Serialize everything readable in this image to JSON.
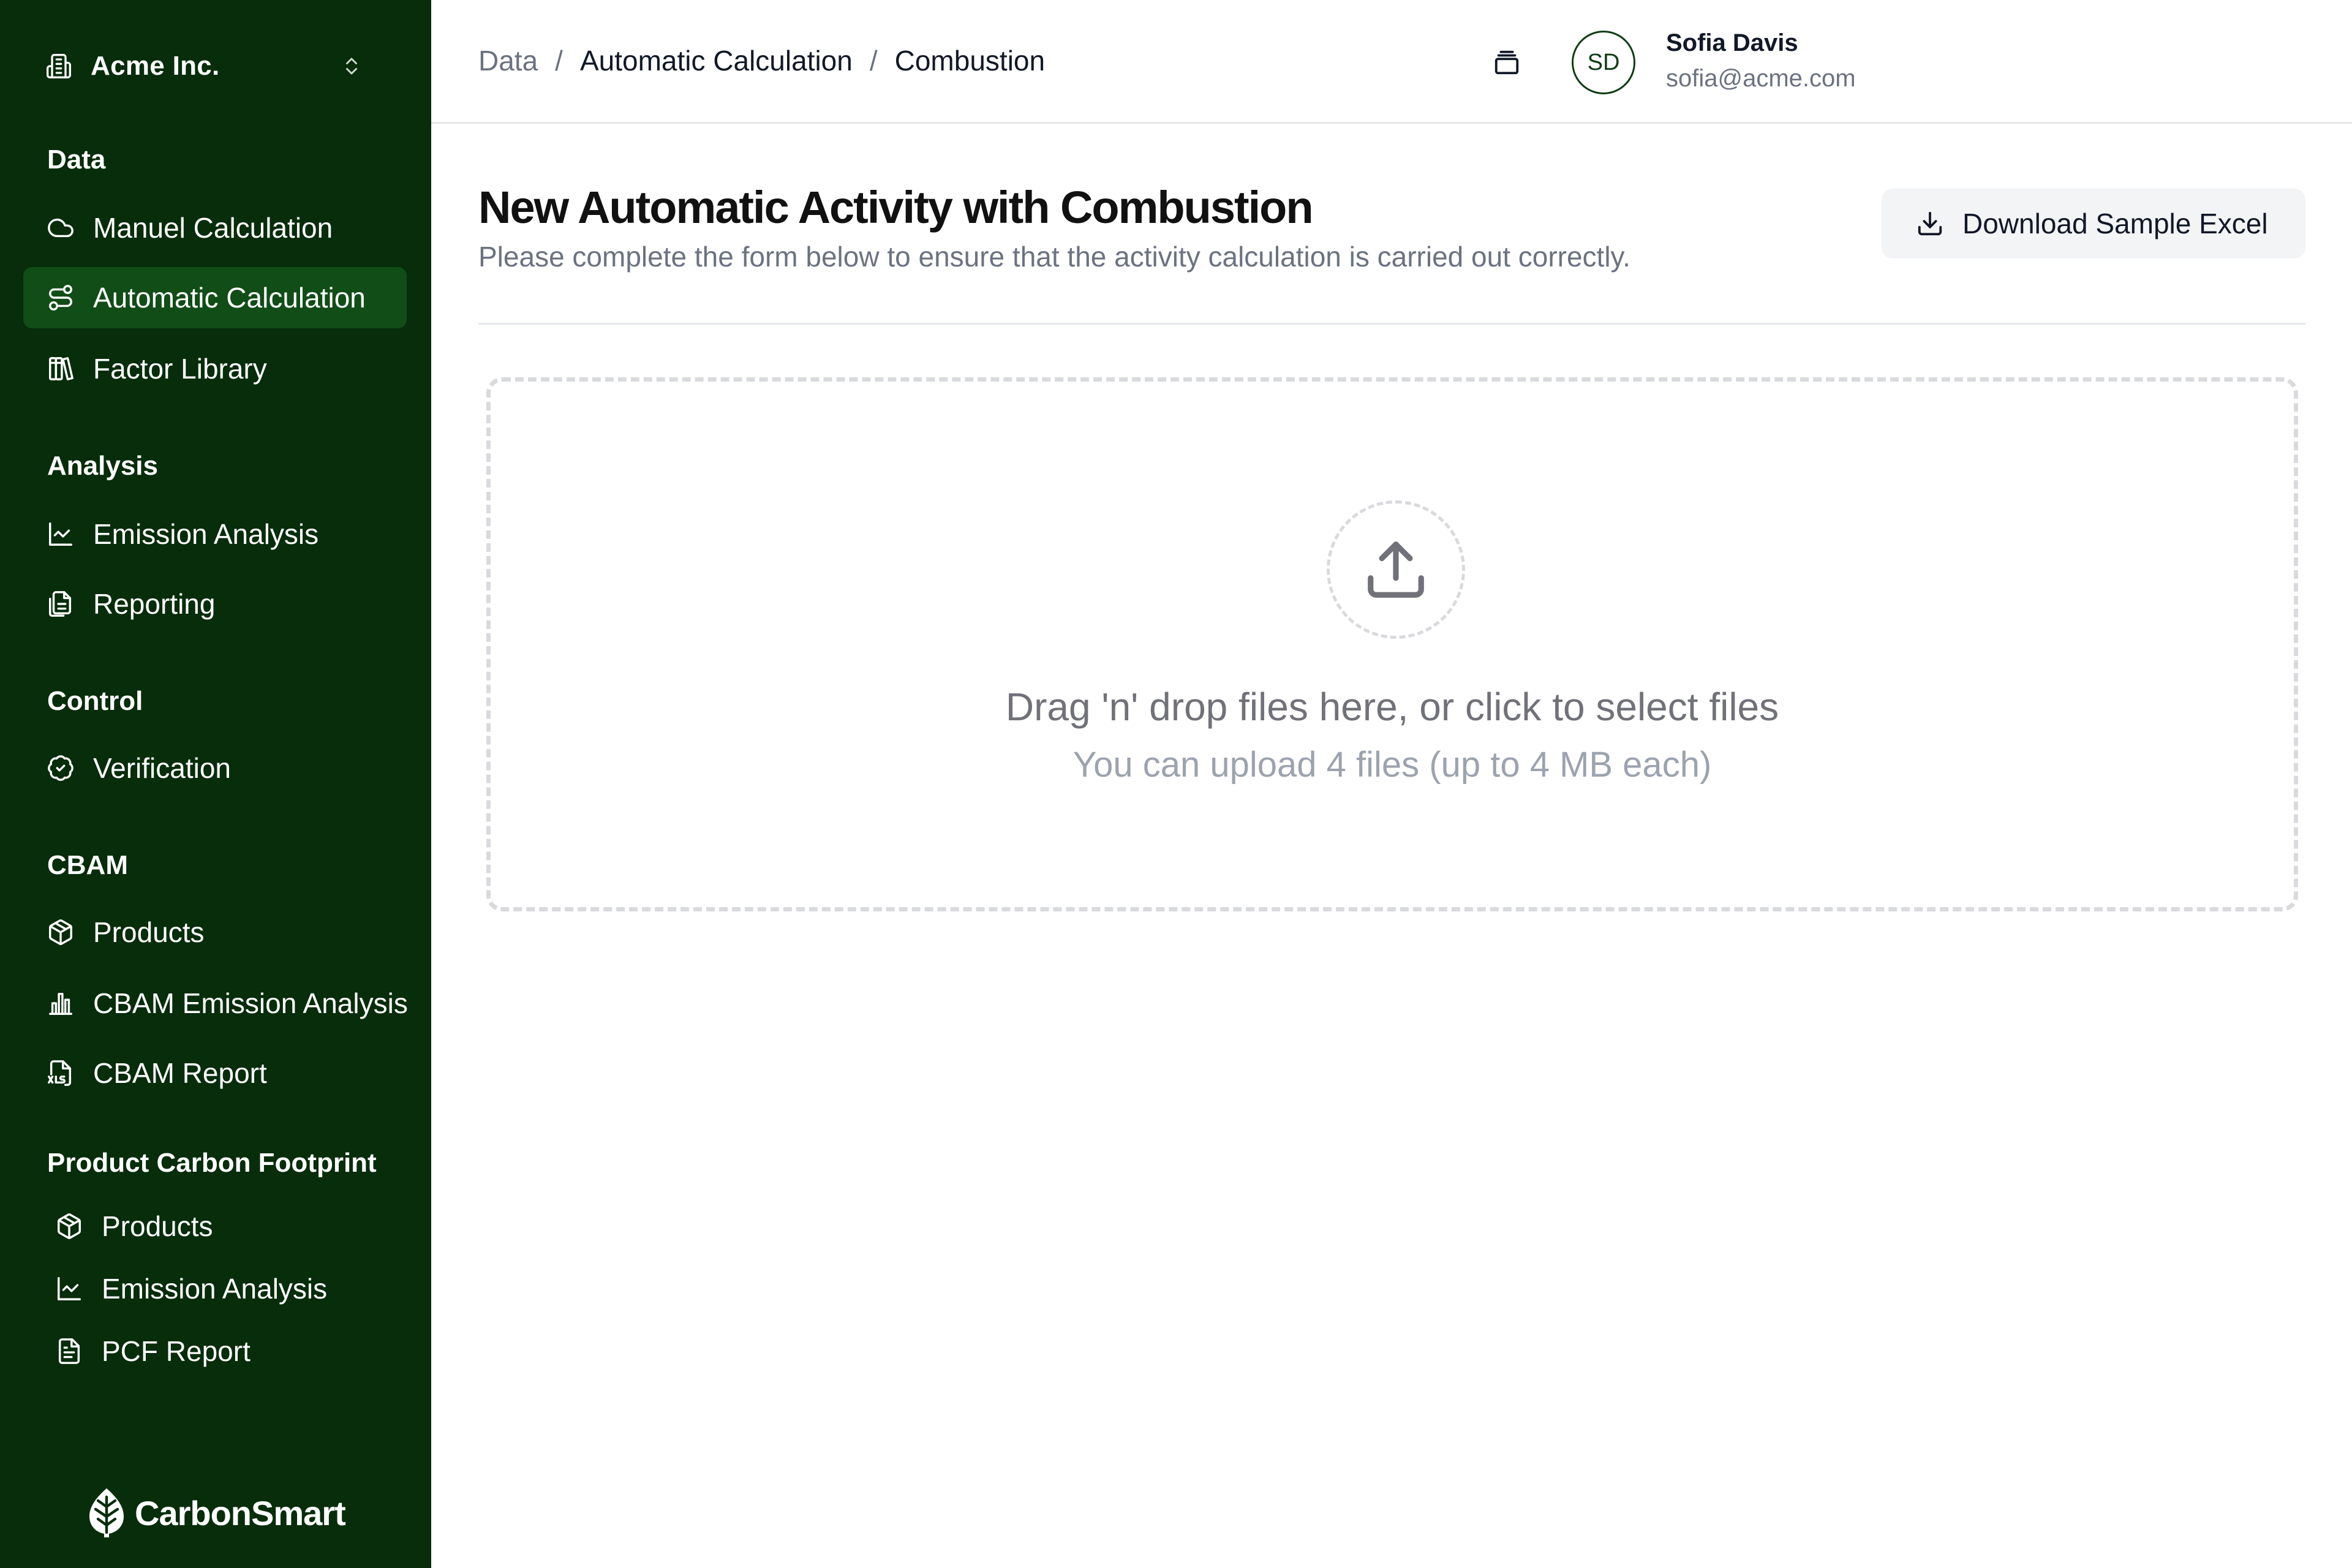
{
  "sidebar": {
    "org": {
      "name": "Acme Inc.",
      "icon": "building-icon"
    },
    "sections": [
      {
        "title": "Data",
        "items": [
          {
            "label": "Manuel Calculation",
            "icon": "cloud-icon"
          },
          {
            "label": "Automatic Calculation",
            "icon": "route-icon",
            "active": true
          },
          {
            "label": "Factor Library",
            "icon": "library-icon"
          }
        ]
      },
      {
        "title": "Analysis",
        "items": [
          {
            "label": "Emission Analysis",
            "icon": "line-chart-icon"
          },
          {
            "label": "Reporting",
            "icon": "files-icon"
          }
        ]
      },
      {
        "title": "Control",
        "items": [
          {
            "label": "Verification",
            "icon": "badge-check-icon"
          }
        ]
      },
      {
        "title": "CBAM",
        "items": [
          {
            "label": "Products",
            "icon": "package-icon"
          },
          {
            "label": "CBAM Emission Analysis",
            "icon": "bar-chart-icon"
          },
          {
            "label": "CBAM Report",
            "icon": "file-xls-icon"
          }
        ]
      },
      {
        "title": "Product Carbon Footprint",
        "items": [
          {
            "label": "Products",
            "icon": "package-icon"
          },
          {
            "label": "Emission Analysis",
            "icon": "line-chart-icon"
          },
          {
            "label": "PCF Report",
            "icon": "file-text-icon"
          }
        ]
      }
    ],
    "brand": {
      "name": "CarbonSmart",
      "icon": "leaf-icon"
    }
  },
  "header": {
    "breadcrumb": [
      "Data",
      "Automatic Calculation",
      "Combustion"
    ],
    "user": {
      "initials": "SD",
      "name": "Sofia Davis",
      "email": "sofia@acme.com"
    },
    "action_icon": "archive-icon"
  },
  "main": {
    "title": "New Automatic Activity with Combustion",
    "subtitle": "Please complete the form below to ensure that the activity calculation is carried out correctly.",
    "download_button": "Download Sample Excel",
    "dropzone": {
      "title": "Drag 'n' drop files here, or click to select files",
      "subtitle": "You can upload 4 files (up to 4 MB each)",
      "icon": "upload-icon"
    }
  },
  "colors": {
    "sidebar_bg": "#072d0b",
    "active_item_bg": "#114d16",
    "accent": "#0f3d14"
  }
}
